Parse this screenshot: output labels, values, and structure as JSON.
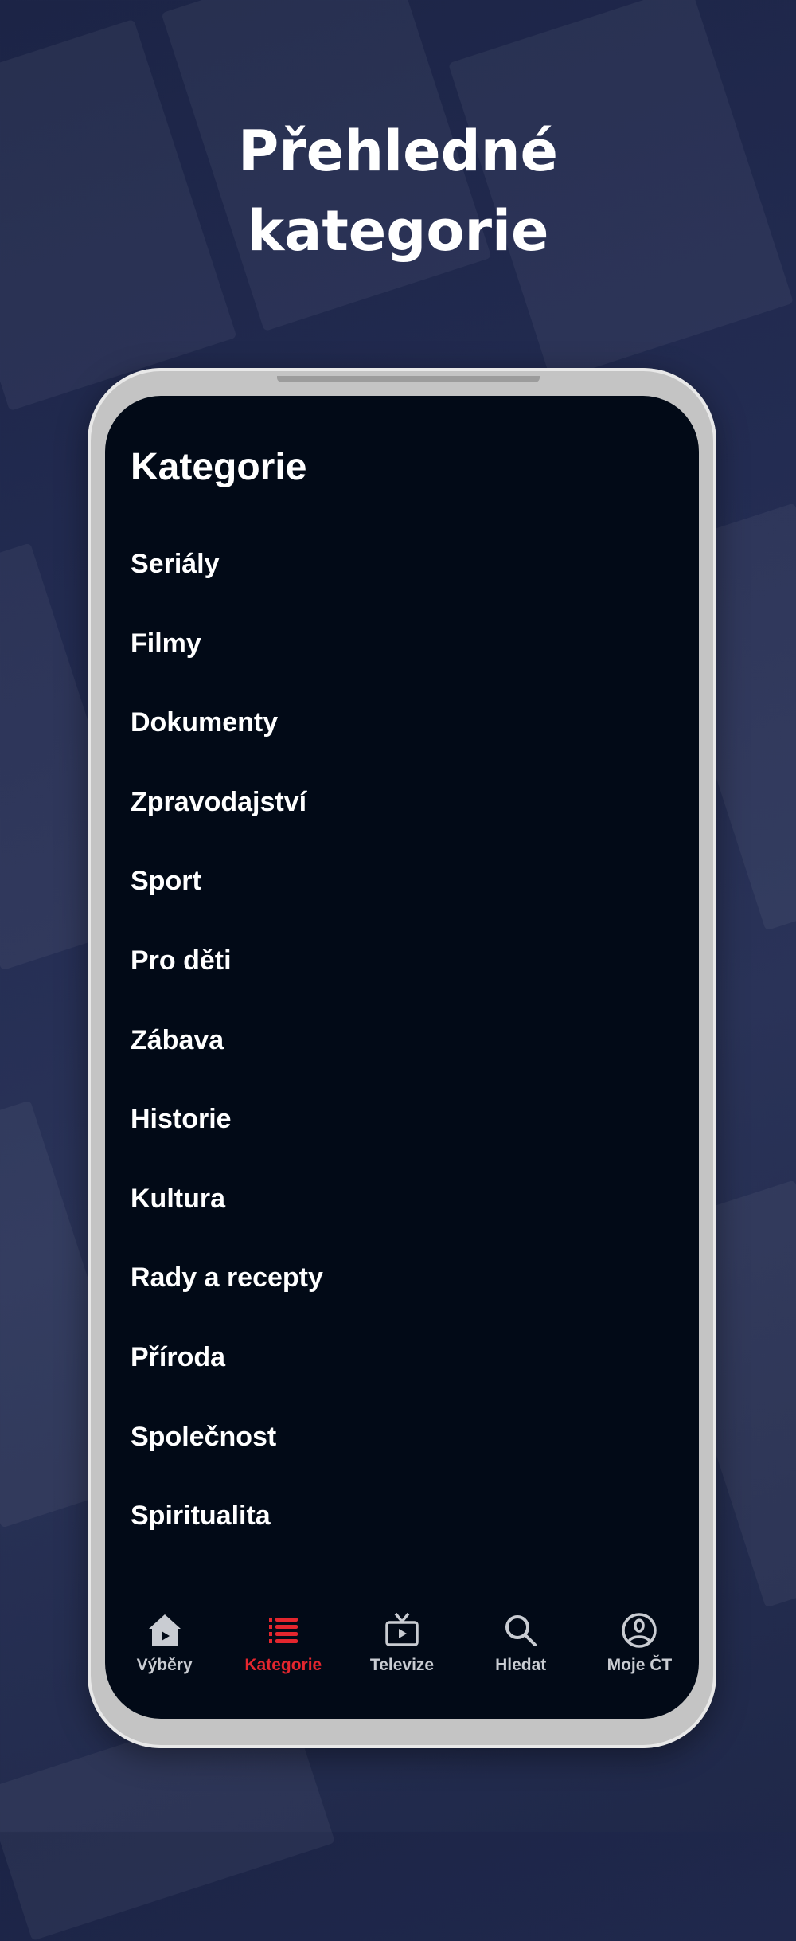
{
  "headline": {
    "line1": "Přehledné",
    "line2": "kategorie"
  },
  "screen": {
    "title": "Kategorie",
    "categories": [
      "Seriály",
      "Filmy",
      "Dokumenty",
      "Zpravodajství",
      "Sport",
      "Pro děti",
      "Zábava",
      "Historie",
      "Kultura",
      "Rady a recepty",
      "Příroda",
      "Společnost",
      "Spiritualita"
    ]
  },
  "nav": {
    "items": [
      {
        "label": "Výběry",
        "icon": "home-play-icon",
        "active": false
      },
      {
        "label": "Kategorie",
        "icon": "list-icon",
        "active": true
      },
      {
        "label": "Televize",
        "icon": "tv-icon",
        "active": false
      },
      {
        "label": "Hledat",
        "icon": "search-icon",
        "active": false
      },
      {
        "label": "Moje ČT",
        "icon": "user-circle-icon",
        "active": false
      }
    ]
  },
  "colors": {
    "accent": "#e4262e",
    "screen_bg": "#020a17",
    "background": "#222b50"
  }
}
